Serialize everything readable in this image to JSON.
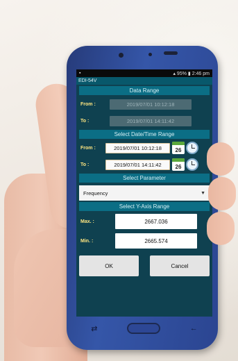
{
  "statusbar": {
    "battery": "95%",
    "time": "2:46 pm"
  },
  "app": {
    "title": "EDI-54V"
  },
  "data_range": {
    "header": "Data Range",
    "from_label": "From :",
    "to_label": "To   :",
    "from_value": "2019/07/01 10:12:18",
    "to_value": "2019/07/01 14:11:42"
  },
  "select_datetime": {
    "header": "Select Date/Time Range",
    "from_label": "From :",
    "to_label": "To   :",
    "from_value": "2019/07/01 10:12:18",
    "to_value": "2019/07/01 14:11:42",
    "calendar_day": "26"
  },
  "parameter": {
    "header": "Select Parameter",
    "selected": "Frequency"
  },
  "y_axis": {
    "header": "Select Y-Axis Range",
    "max_label": "Max.  :",
    "min_label": "Min.   :",
    "max_value": "2667.036",
    "min_value": "2665.574"
  },
  "buttons": {
    "ok": "OK",
    "cancel": "Cancel"
  }
}
